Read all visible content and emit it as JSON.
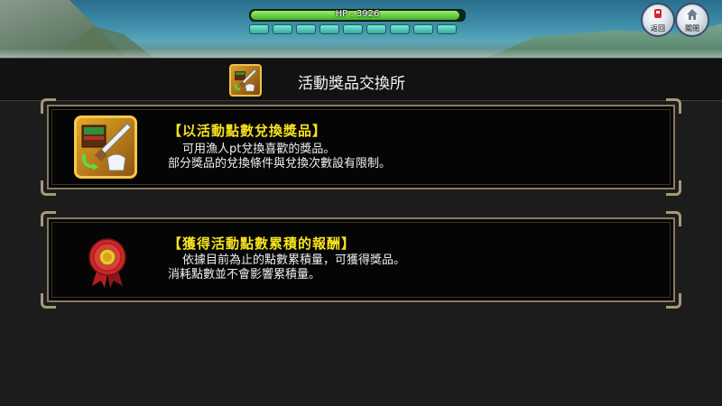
{
  "hud": {
    "hp_label": "HP : 3926",
    "hp_fraction": 0.98,
    "energy_segments_total": 9,
    "energy_segments_filled": 9
  },
  "top_buttons": {
    "back": {
      "label": "返回",
      "icon": "back-icon"
    },
    "close": {
      "label": "關閉",
      "icon": "home-icon"
    }
  },
  "header": {
    "title": "活動獎品交換所",
    "icon": "exchange-shop-icon"
  },
  "panels": [
    {
      "title": "【以活動點數兌換獎品】",
      "lines": [
        "可用漁人pt兌換喜歡的獎品。",
        "部分獎品的兌換條件與兌換次數設有限制。"
      ],
      "icon": "reward-exchange-icon"
    },
    {
      "title": "【獲得活動點數累積的報酬】",
      "lines": [
        "依據目前為止的點數累積量，可獲得獎品。",
        "消耗點數並不會影響累積量。"
      ],
      "icon": "medal-icon"
    }
  ],
  "colors": {
    "title_yellow": "#f6e21c",
    "panel_border": "#8a7c62",
    "hp_green": "#3fb02a",
    "energy_cyan": "#33a99c"
  }
}
